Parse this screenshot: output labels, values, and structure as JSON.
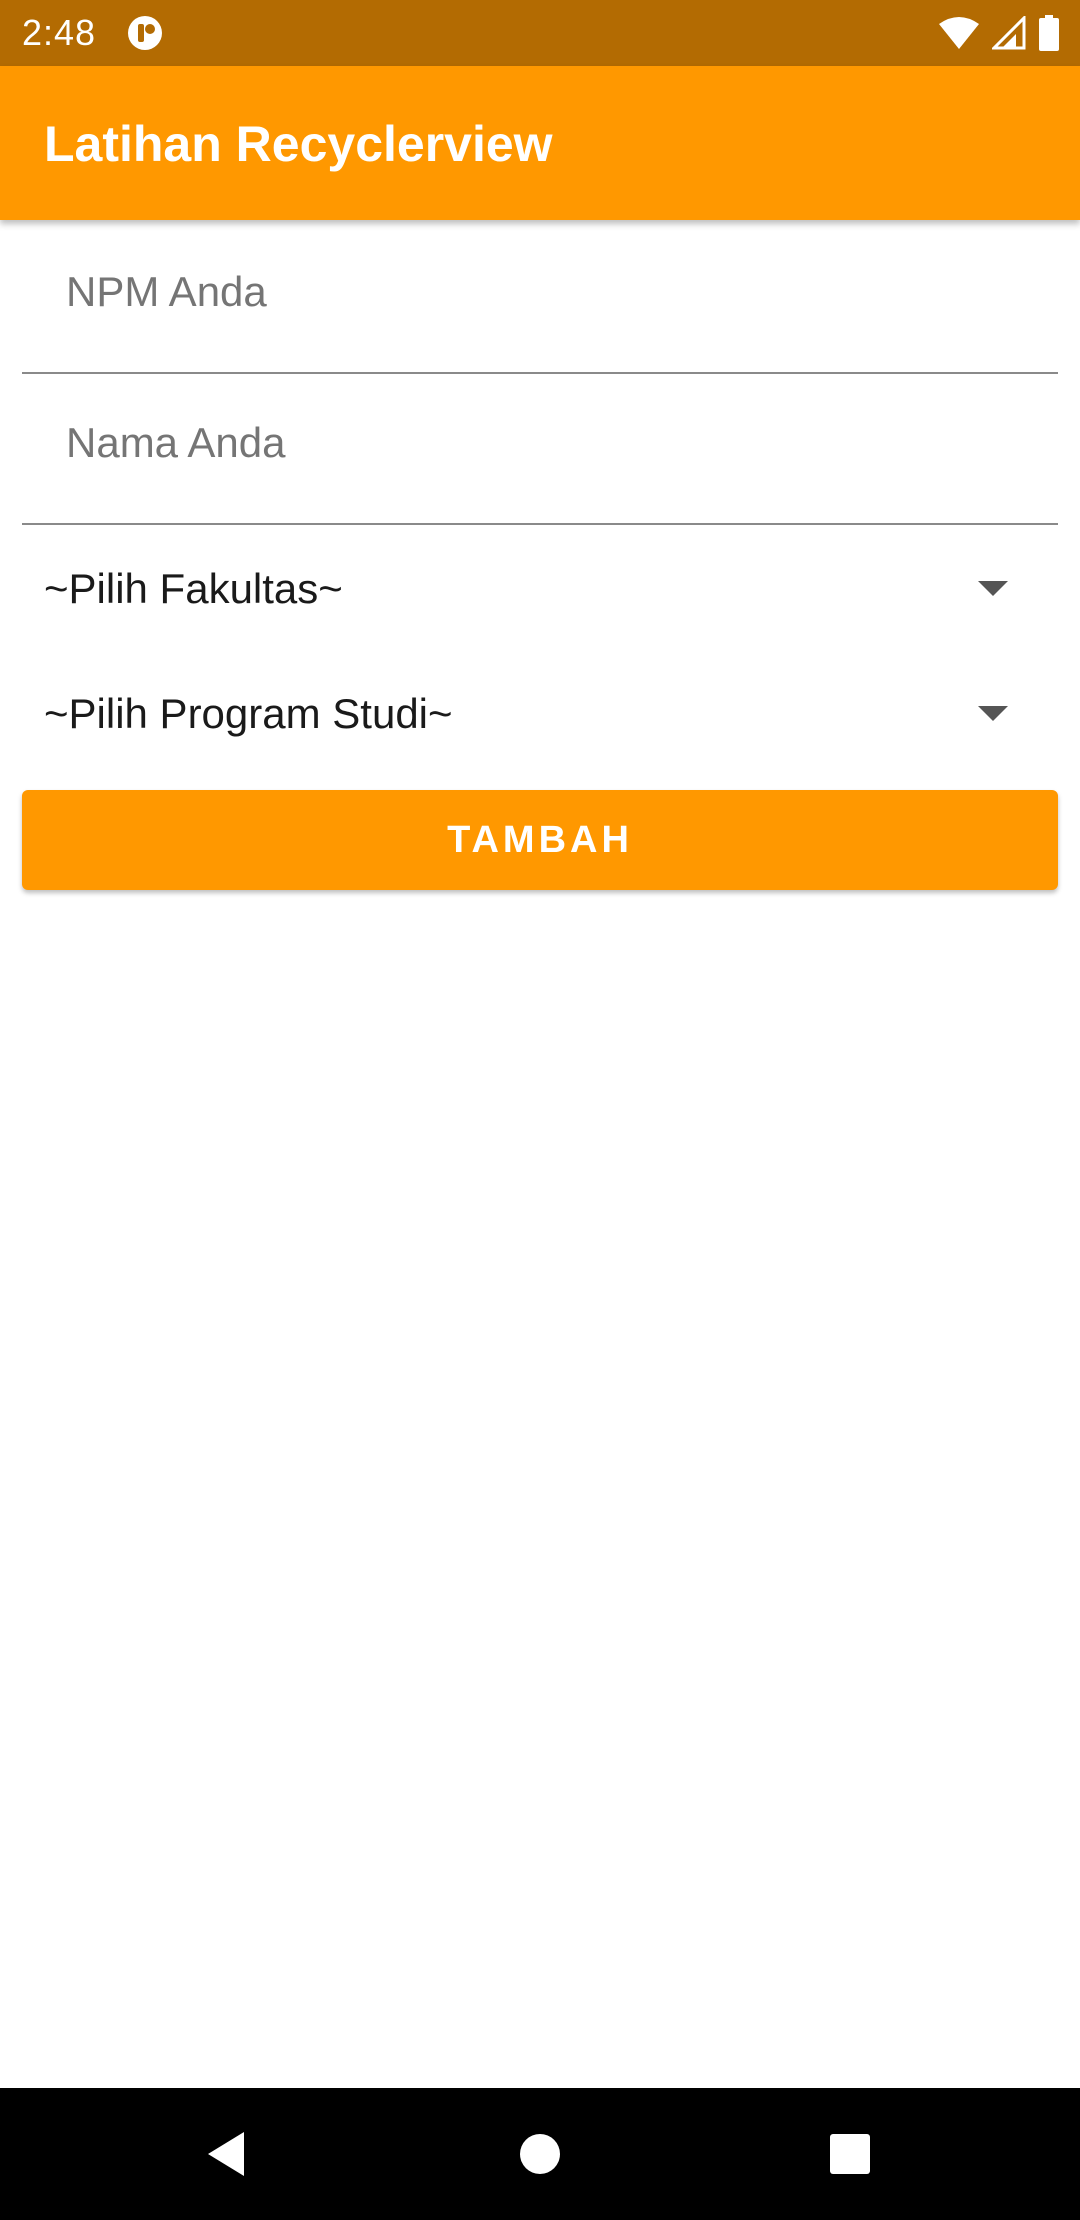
{
  "status_bar": {
    "time": "2:48",
    "icons": [
      "app-notification-icon",
      "wifi-icon",
      "cell-signal-icon",
      "battery-icon"
    ]
  },
  "app_bar": {
    "title": "Latihan Recyclerview",
    "color": "#ff9800"
  },
  "form": {
    "npm_placeholder": "NPM Anda",
    "npm_value": "",
    "nama_placeholder": "Nama Anda",
    "nama_value": "",
    "fakultas_selected": "~Pilih Fakultas~",
    "prodi_selected": "~Pilih Program Studi~",
    "add_button_label": "TAMBAH"
  },
  "nav_bar": {
    "icons": [
      "back-icon",
      "home-icon",
      "recents-icon"
    ]
  },
  "colors": {
    "primary": "#ff9800",
    "primary_dark": "#b36b02",
    "nav_bar": "#000000"
  }
}
